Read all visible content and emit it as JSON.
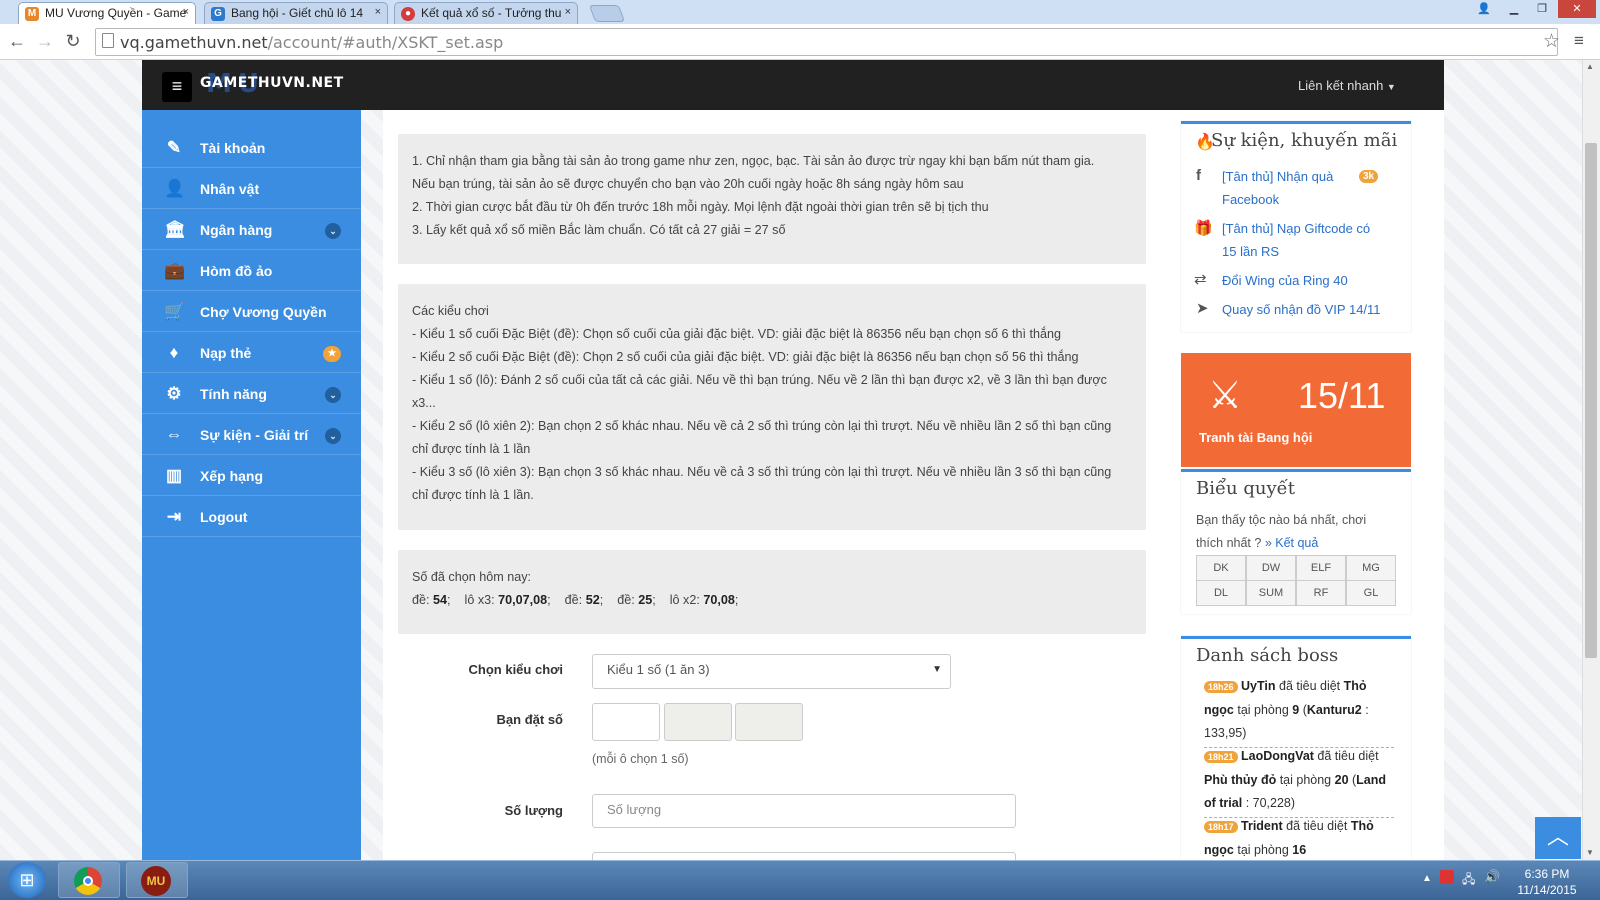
{
  "browser": {
    "tabs": [
      {
        "title": "MU Vương Quyền - Game",
        "close": "×"
      },
      {
        "title": "Bang hội - Giết chủ lô 14",
        "close": "×"
      },
      {
        "title": "Kết quả xổ số - Tưởng thu",
        "close": "×"
      }
    ],
    "url_host": "vq.gamethuvn.net",
    "url_path": "/account/#auth/XSKT_set.asp"
  },
  "topnav": {
    "logo": "GAMETHUVN.NET",
    "logo_mu": "MU",
    "quick_link": "Liên kết nhanh"
  },
  "sidebar": {
    "items": [
      {
        "label": "Tài khoản",
        "icon": "edit-icon",
        "glyph": "✎"
      },
      {
        "label": "Nhân vật",
        "icon": "user-icon",
        "glyph": "👤"
      },
      {
        "label": "Ngân hàng",
        "icon": "bank-icon",
        "glyph": "🏛"
      },
      {
        "label": "Hòm đồ ảo",
        "icon": "briefcase-icon",
        "glyph": "💼"
      },
      {
        "label": "Chợ Vương Quyền",
        "icon": "cart-icon",
        "glyph": "🛒"
      },
      {
        "label": "Nạp thẻ",
        "icon": "diamond-icon",
        "glyph": "♦"
      },
      {
        "label": "Tính năng",
        "icon": "cogs-icon",
        "glyph": "⚙"
      },
      {
        "label": "Sự kiện - Giải trí",
        "icon": "arrows-icon",
        "glyph": "⇔"
      },
      {
        "label": "Xếp hạng",
        "icon": "chart-icon",
        "glyph": "▥"
      },
      {
        "label": "Logout",
        "icon": "logout-icon",
        "glyph": "⇥"
      }
    ]
  },
  "rules": {
    "line1": "1. Chỉ nhận tham gia bằng tài sản ảo trong game như zen, ngọc, bạc. Tài sản ảo được trừ ngay khi bạn bấm nút tham gia.",
    "line2": "Nếu bạn trúng, tài sản ảo sẽ được chuyển cho bạn vào 20h cuối ngày hoặc 8h sáng ngày hôm sau",
    "line3": "2. Thời gian cược bắt đầu từ 0h đến trước 18h mỗi ngày. Mọi lệnh đặt ngoài thời gian trên sẽ bị tịch thu",
    "line4": "3. Lấy kết quả xổ số miền Bắc làm chuẩn. Có tất cả 27 giải = 27 số"
  },
  "types": {
    "heading": "Các kiểu chơi",
    "l1": "- Kiểu 1 số cuối Đặc Biệt (đề): Chọn số cuối của giải đặc biệt. VD: giải đặc biệt là 86356 nếu bạn chọn số 6 thì thắng",
    "l2": "- Kiểu 2 số cuối Đặc Biệt (đề): Chọn 2 số cuối của giải đặc biệt. VD: giải đặc biệt là 86356 nếu bạn chọn số 56 thì thắng",
    "l3": "- Kiểu 1 số (lô): Đánh 2 số cuối của tất cả các giải. Nếu về thì bạn trúng. Nếu về 2 lần thì bạn được x2, về 3 lần thì bạn được",
    "l3b": "x3...",
    "l4": "- Kiểu 2 số (lô xiên 2): Bạn chọn 2 số khác nhau. Nếu về cả 2 số thì trúng còn lại thì trượt. Nếu về nhiều lần 2 số thì bạn cũng",
    "l4b": "chỉ được tính là 1 lần",
    "l5": "- Kiểu 3 số (lô xiên 3): Bạn chọn 3 số khác nhau. Nếu về cả 3 số thì trúng còn lại thì trượt. Nếu về nhiều lần 3 số thì bạn cũng",
    "l5b": "chỉ được tính là 1 lần."
  },
  "chosen": {
    "heading": "Số đã chọn hôm nay:",
    "entries": [
      {
        "label": "đề:",
        "value": "54"
      },
      {
        "label": "lô x3:",
        "value": "70,07,08"
      },
      {
        "label": "đề:",
        "value": "52"
      },
      {
        "label": "đề:",
        "value": "25"
      },
      {
        "label": "lô x2:",
        "value": "70,08"
      }
    ]
  },
  "form": {
    "type_label": "Chọn kiểu chơi",
    "type_value": "Kiểu 1 số (1 ăn 3)",
    "number_label": "Bạn đặt số",
    "number_hint": "(mỗi ô chọn 1 số)",
    "qty_label": "Số lượng",
    "qty_placeholder": "Số lượng"
  },
  "events": {
    "title": "Sự kiện, khuyến mãi",
    "items": [
      {
        "text": "[Tân thủ] Nhận quà Facebook",
        "badge": "3k",
        "icon": "facebook-icon",
        "glyph": "f"
      },
      {
        "text": "[Tân thủ] Nạp Giftcode có 15 lần RS",
        "icon": "gift-icon",
        "glyph": "🎁"
      },
      {
        "text": "Đổi Wing của Ring 40",
        "icon": "exchange-icon",
        "glyph": "⇄"
      },
      {
        "text": "Quay số nhận đồ VIP 14/11",
        "icon": "pointer-icon",
        "glyph": "➤"
      }
    ]
  },
  "banner": {
    "date": "15/11",
    "caption": "Tranh tài Bang hội",
    "accent": "#f26a36"
  },
  "poll": {
    "title": "Biểu quyết",
    "question": "Bạn thấy tộc nào bá nhất, chơi thích nhất ?",
    "result_link": "» Kết quả",
    "options": [
      "DK",
      "DW",
      "ELF",
      "MG",
      "DL",
      "SUM",
      "RF",
      "GL"
    ]
  },
  "bosses": {
    "title": "Danh sách boss",
    "b1": {
      "time": "18h26",
      "player": "UyTin",
      "killed": "đã tiêu diệt",
      "boss": "Thỏ ngọc",
      "room_pre": "tại phòng",
      "room": "9",
      "map": "Kanturu2",
      "coords": ": 133,95)"
    },
    "b2": {
      "time": "18h21",
      "player": "LaoDongVat",
      "killed": "đã tiêu diệt",
      "boss": "Phù thủy đỏ",
      "room_pre": "tại phòng",
      "room": "20",
      "map": "Land of trial",
      "coords": ": 70,228)"
    },
    "b3": {
      "time": "18h17",
      "player": "Trident",
      "killed": "đã tiêu diệt",
      "boss": "Thỏ ngọc",
      "room_pre": "tại phòng",
      "room": "16"
    }
  },
  "taskbar": {
    "time": "6:36 PM",
    "date": "11/14/2015"
  },
  "colors": {
    "sidebar": "#3a8de0",
    "topbar": "#212121",
    "banner": "#f26a36"
  }
}
